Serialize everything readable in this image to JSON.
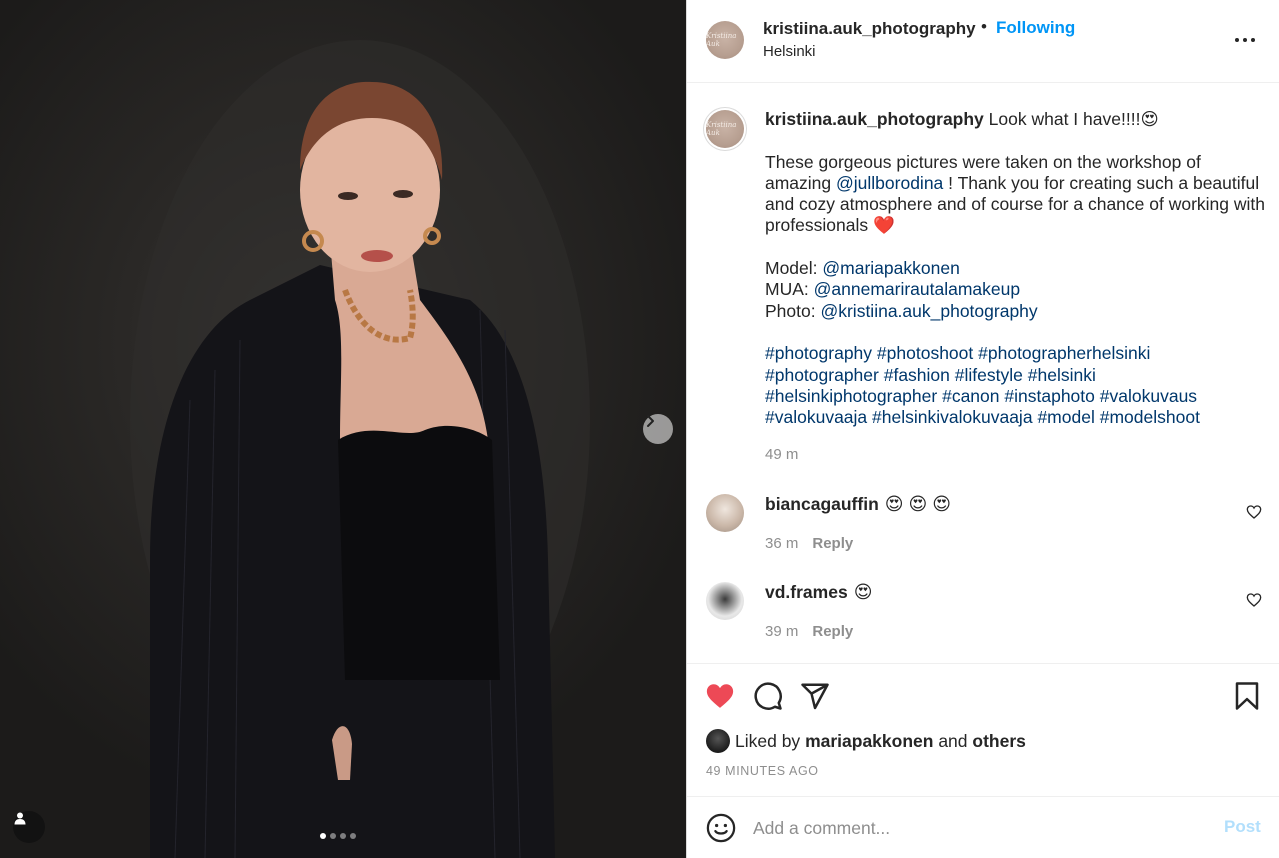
{
  "post": {
    "author": "kristiina.auk_photography",
    "separator": "•",
    "follow_state": "Following",
    "location": "Helsinki",
    "avatar_signature": "Kristiina Auk",
    "carousel": {
      "slides": 4,
      "active_index": 0
    }
  },
  "caption": {
    "username": "kristiina.auk_photography",
    "headline": "Look what I have!!!!",
    "headline_emoji": "😍",
    "p1_before": "These gorgeous pictures were taken on the workshop of amazing ",
    "p1_mention": "@jullborodina",
    "p1_after": " ! Thank you for creating such a beautiful and cozy atmosphere and of course for a chance of working with professionals ",
    "p1_emoji": "❤️",
    "credits": [
      {
        "label": "Model: ",
        "mention": "@mariapakkonen"
      },
      {
        "label": "MUA: ",
        "mention": "@annemarirautalamakeup"
      },
      {
        "label": "Photo: ",
        "mention": "@kristiina.auk_photography"
      }
    ],
    "hashtags": [
      "#photography",
      "#photoshoot",
      "#photographerhelsinki",
      "#photographer",
      "#fashion",
      "#lifestyle",
      "#helsinki",
      "#helsinkiphotographer",
      "#canon",
      "#instaphoto",
      "#valokuvaus",
      "#valokuvaaja",
      "#helsinkivalokuvaaja",
      "#model",
      "#modelshoot"
    ],
    "time": "49 m"
  },
  "comments": [
    {
      "user": "biancagauffin",
      "text": "😍 😍 😍",
      "time": "36 m",
      "reply": "Reply"
    },
    {
      "user": "vd.frames",
      "text": "😍",
      "time": "39 m",
      "reply": "Reply"
    }
  ],
  "likes": {
    "prefix": "Liked by",
    "user": "mariapakkonen",
    "and": "and",
    "others": "others"
  },
  "timestamp": "49 MINUTES AGO",
  "add_comment": {
    "placeholder": "Add a comment...",
    "post_label": "Post"
  },
  "icons": {
    "like": "heart-filled-icon",
    "comment": "comment-icon",
    "share": "share-icon",
    "save": "bookmark-icon",
    "more": "more-options-icon",
    "next": "chevron-right-icon",
    "tags": "user-tag-icon",
    "emoji": "emoji-icon"
  },
  "colors": {
    "link": "#00376b",
    "follow": "#0095f6",
    "like": "#ed4956",
    "post_disabled": "#b2dffc",
    "meta": "#8e8e8e"
  }
}
